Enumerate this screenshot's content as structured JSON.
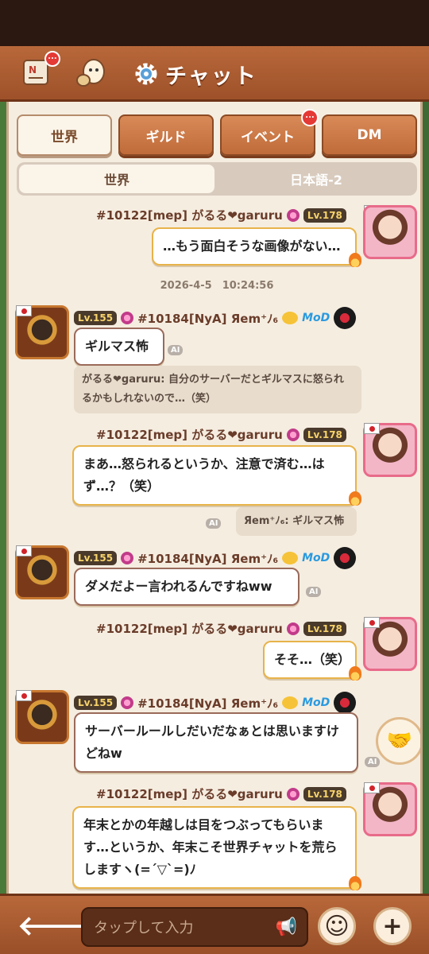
{
  "header": {
    "title": "チャット",
    "notice_badge": "...",
    "icons": [
      "notice-board-icon",
      "friend-icon",
      "gear-icon"
    ]
  },
  "tabs": [
    {
      "label": "世界",
      "active": true,
      "badge": ""
    },
    {
      "label": "ギルド",
      "active": false,
      "badge": ""
    },
    {
      "label": "イベント",
      "active": false,
      "badge": "..."
    },
    {
      "label": "DM",
      "active": false,
      "badge": ""
    }
  ],
  "subtabs": [
    {
      "label": "世界",
      "active": true
    },
    {
      "label": "日本語-2",
      "active": false
    }
  ],
  "timestamp": "2026-4-5　10:24:56",
  "users": {
    "garuru": {
      "name": "#10122[mep] がるる❤garuru",
      "level": "Lv.178"
    },
    "nyrem": {
      "name": "#10184[NyA] Яem⁺ﾉ₆",
      "level": "Lv.155",
      "mod": "MoD"
    }
  },
  "messages": [
    {
      "user": "garuru",
      "text": "…もう面白そうな画像がない…"
    },
    {
      "user": "nyrem",
      "text": "ギルマス怖",
      "reply": "がるる❤garuru: 自分のサーバーだとギルマスに怒られるかもしれないので…（笑）",
      "ai": "AI"
    },
    {
      "user": "garuru",
      "text": "まあ…怒られるというか、注意で済む…はず…？（笑）",
      "reply": "Яem⁺ﾉ₆: ギルマス怖",
      "ai": "AI"
    },
    {
      "user": "nyrem",
      "text": "ダメだよー言われるんですねww",
      "ai": "AI"
    },
    {
      "user": "garuru",
      "text": "そそ…（笑）"
    },
    {
      "user": "nyrem",
      "text": "サーバールールしだいだなぁとは思いますけどねw",
      "ai": "AI"
    },
    {
      "user": "garuru",
      "text": "年末とかの年越しは目をつぶってもらいます…というか、年末こそ世界チャットを荒らしますヽ(=´▽`=)ﾉ"
    }
  ],
  "input": {
    "placeholder": "タップして入力"
  },
  "colors": {
    "header": "#b8683a",
    "panel": "#f5ede0",
    "accent": "#e8b34a",
    "badge": "#e53935"
  }
}
